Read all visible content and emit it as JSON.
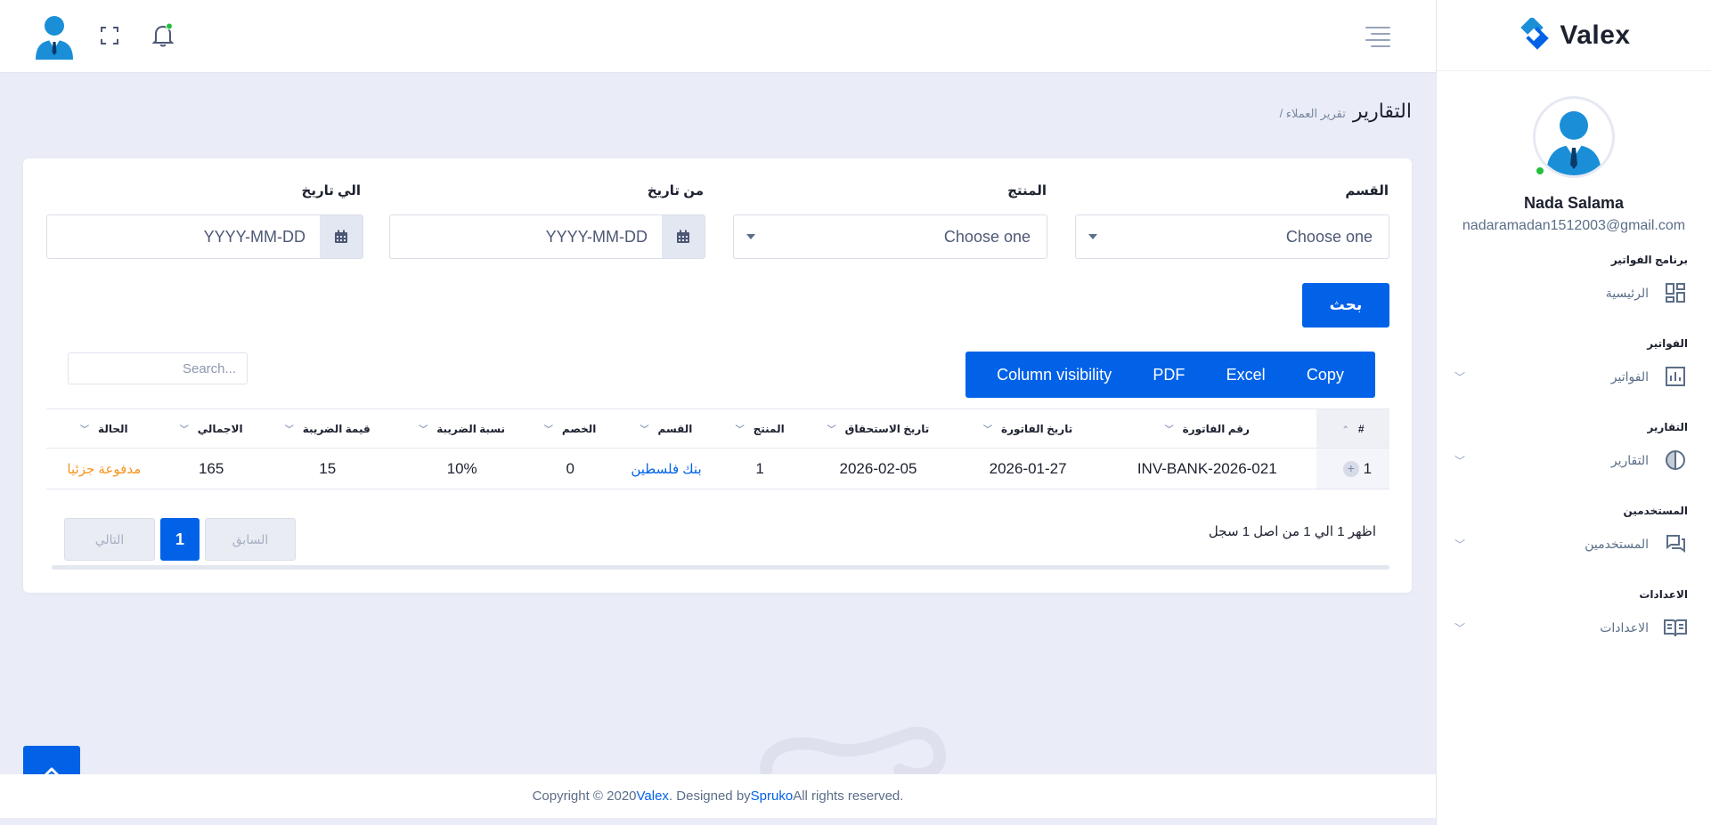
{
  "app": {
    "brand": "Valex"
  },
  "user": {
    "name": "Nada Salama",
    "email": "nadaramadan1512003@gmail.com"
  },
  "sidebar": {
    "sections": [
      {
        "title": "برنامج الفواتير",
        "item": "الرئيسية",
        "icon": "dashboard-icon"
      },
      {
        "title": "الفواتير",
        "item": "الفواتير",
        "icon": "bar-chart-icon"
      },
      {
        "title": "التقارير",
        "item": "التقارير",
        "icon": "pie-chart-icon"
      },
      {
        "title": "المستخدمين",
        "item": "المستخدمين",
        "icon": "chat-icon"
      },
      {
        "title": "الاعدادات",
        "item": "الاعدادات",
        "icon": "book-icon"
      }
    ]
  },
  "page": {
    "title": "التقارير",
    "breadcrumb": "/ تقرير العملاء"
  },
  "filters": {
    "section_label": "القسم",
    "section_value": "Choose one",
    "product_label": "المنتج",
    "product_value": "Choose one",
    "from_label": "من تاريخ",
    "from_placeholder": "YYYY-MM-DD",
    "to_label": "الي تاريخ",
    "to_placeholder": "YYYY-MM-DD",
    "search_button": "بحث"
  },
  "table_tools": {
    "buttons": [
      "Copy",
      "Excel",
      "PDF",
      "Column visibility"
    ],
    "search_placeholder": "Search..."
  },
  "table": {
    "headers": [
      "#",
      "رقم الفاتورة",
      "تاريخ الفاتورة",
      "تاريخ الاستحقاق",
      "المنتج",
      "القسم",
      "الخصم",
      "نسبة الضريبة",
      "قيمة الضريبة",
      "الاجمالي",
      "الحالة"
    ],
    "rows": [
      [
        "1",
        "INV-BANK-2026-021",
        "2026-01-27",
        "2026-02-05",
        "1",
        "بنك فلسطين",
        "0",
        "10%",
        "15",
        "165",
        "مدفوعة جزئيا"
      ]
    ]
  },
  "pagination": {
    "info": "اظهر 1 الي 1 من اصل 1 سجل",
    "prev": "السابق",
    "current": "1",
    "next": "التالي"
  },
  "footer": {
    "prefix": "Copyright © 2020 ",
    "brand": "Valex",
    "mid": ". Designed by ",
    "designer": "Spruko",
    "suffix": " All rights reserved."
  },
  "colors": {
    "primary": "#0162e8",
    "status_partial": "#f7931e",
    "online": "#22c03c"
  }
}
